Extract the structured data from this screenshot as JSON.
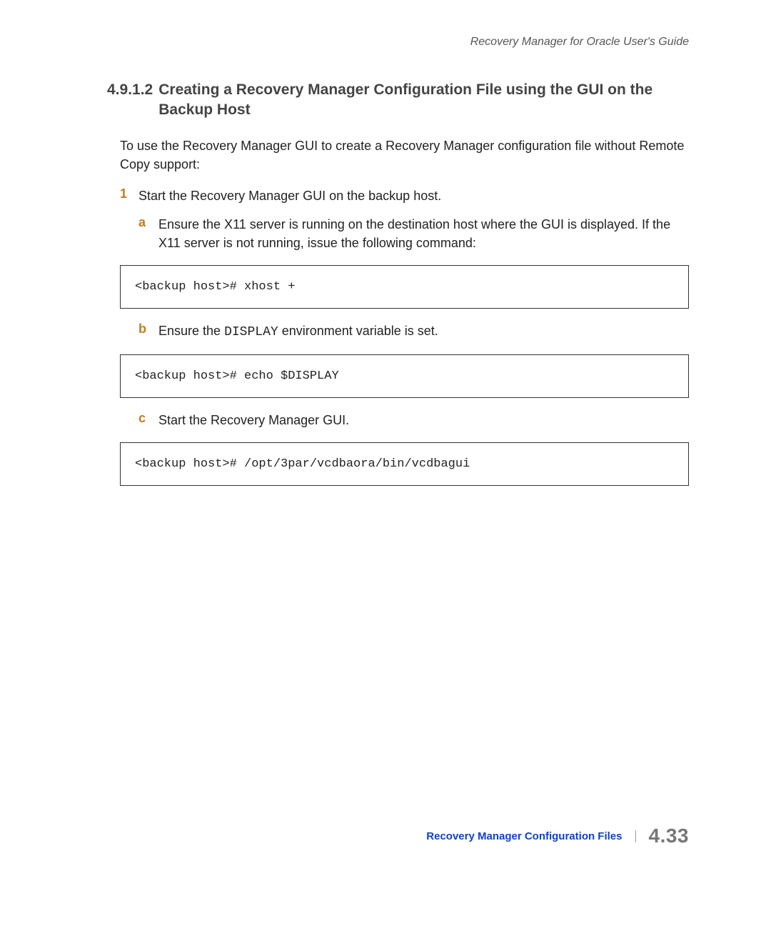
{
  "header": {
    "running_title": "Recovery Manager for Oracle User's Guide"
  },
  "section": {
    "number": "4.9.1.2",
    "title": "Creating a Recovery Manager Configuration File using the GUI on the Backup Host"
  },
  "intro": "To use the Recovery Manager GUI to create a Recovery Manager configuration file without Remote Copy support:",
  "step1": {
    "num": "1",
    "text": "Start the Recovery Manager GUI on the backup host."
  },
  "sub_a": {
    "letter": "a",
    "text": "Ensure the X11 server is running on the destination host where the GUI is displayed. If the X11 server is not running, issue the following command:"
  },
  "code_a": "<backup host># xhost +",
  "sub_b": {
    "letter": "b",
    "text_pre": "Ensure the ",
    "code": "DISPLAY",
    "text_post": " environment variable is set."
  },
  "code_b": "<backup host># echo $DISPLAY",
  "sub_c": {
    "letter": "c",
    "text": "Start the Recovery Manager GUI."
  },
  "code_c": "<backup host># /opt/3par/vcdbaora/bin/vcdbagui",
  "footer": {
    "section_name": "Recovery Manager Configuration Files",
    "page_number": "4.33"
  }
}
